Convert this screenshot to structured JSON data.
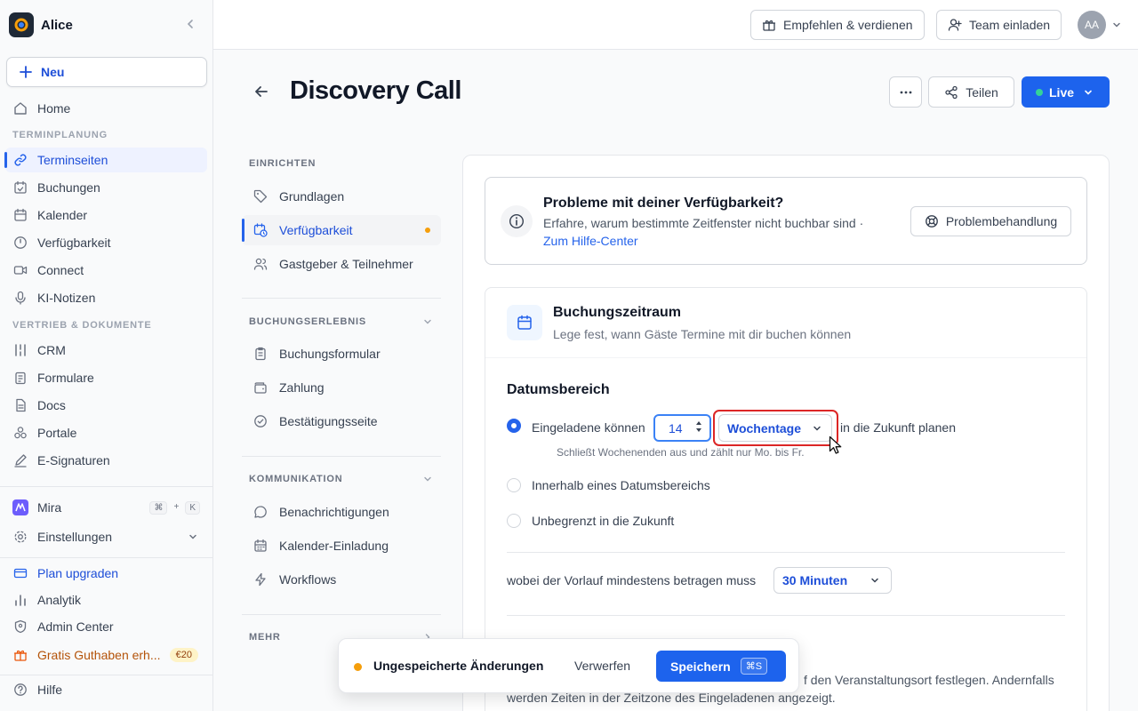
{
  "workspace": {
    "name": "Alice"
  },
  "sidebar": {
    "new_label": "Neu",
    "home": "Home",
    "section_scheduling": "TERMINPLANUNG",
    "scheduling_items": [
      {
        "label": "Terminseiten",
        "icon": "link-icon"
      },
      {
        "label": "Buchungen",
        "icon": "calendar-check-icon"
      },
      {
        "label": "Kalender",
        "icon": "calendar-icon"
      },
      {
        "label": "Verfügbarkeit",
        "icon": "clock-icon"
      },
      {
        "label": "Connect",
        "icon": "video-icon"
      },
      {
        "label": "KI-Notizen",
        "icon": "microphone-icon"
      }
    ],
    "section_sales": "VERTRIEB & DOKUMENTE",
    "sales_items": [
      {
        "label": "CRM",
        "icon": "crm-icon"
      },
      {
        "label": "Formulare",
        "icon": "clipboard-icon"
      },
      {
        "label": "Docs",
        "icon": "document-icon"
      },
      {
        "label": "Portale",
        "icon": "portal-icon"
      },
      {
        "label": "E-Signaturen",
        "icon": "pen-icon"
      }
    ],
    "mira": "Mira",
    "mira_shortcut": [
      "⌘",
      "+",
      "K"
    ],
    "settings": "Einstellungen",
    "upgrade": "Plan upgraden",
    "analytics": "Analytik",
    "admin": "Admin Center",
    "credit": "Gratis Guthaben erh...",
    "credit_badge": "€20",
    "help": "Hilfe"
  },
  "topbar": {
    "refer": "Empfehlen & verdienen",
    "invite": "Team einladen",
    "avatar_initials": "AA"
  },
  "header": {
    "title": "Discovery Call",
    "share": "Teilen",
    "status": "Live"
  },
  "settings_nav": {
    "setup_label": "EINRICHTEN",
    "setup_items": [
      "Grundlagen",
      "Verfügbarkeit",
      "Gastgeber & Teilnehmer"
    ],
    "booking_label": "BUCHUNGSERLEBNIS",
    "booking_items": [
      "Buchungsformular",
      "Zahlung",
      "Bestätigungsseite"
    ],
    "comm_label": "KOMMUNIKATION",
    "comm_items": [
      "Benachrichtigungen",
      "Kalender-Einladung",
      "Workflows"
    ],
    "more_label": "MEHR"
  },
  "info": {
    "title": "Probleme mit deiner Verfügbarkeit?",
    "text": "Erfahre, warum bestimmte Zeitfenster nicht buchbar sind ·",
    "link": "Zum Hilfe-Center",
    "button": "Problembehandlung"
  },
  "booking_window": {
    "title": "Buchungszeitraum",
    "subtitle": "Lege fest, wann Gäste Termine mit dir buchen können",
    "range_title": "Datumsbereich",
    "option1_prefix": "Eingeladene können",
    "days_value": "14",
    "unit": "Wochentage",
    "option1_suffix": "in die Zukunft planen",
    "hint": "Schließt Wochenenden aus und zählt nur Mo. bis Fr.",
    "option2": "Innerhalb eines Datumsbereichs",
    "option3": "Unbegrenzt in die Zukunft",
    "selected_option": 1,
    "lead_text": "wobei der Vorlauf mindestens betragen muss",
    "lead_value": "30 Minuten",
    "timezone_tail": "f den Veranstaltungsort festlegen. Andernfalls",
    "timezone_line2": "werden Zeiten in der Zeitzone des Eingeladenen angezeigt."
  },
  "toast": {
    "message": "Ungespeicherte Änderungen",
    "discard": "Verwerfen",
    "save": "Speichern",
    "shortcut": "⌘S"
  },
  "colors": {
    "accent": "#1d63ed",
    "warning": "#f59e0b",
    "highlight": "#dc2626"
  }
}
